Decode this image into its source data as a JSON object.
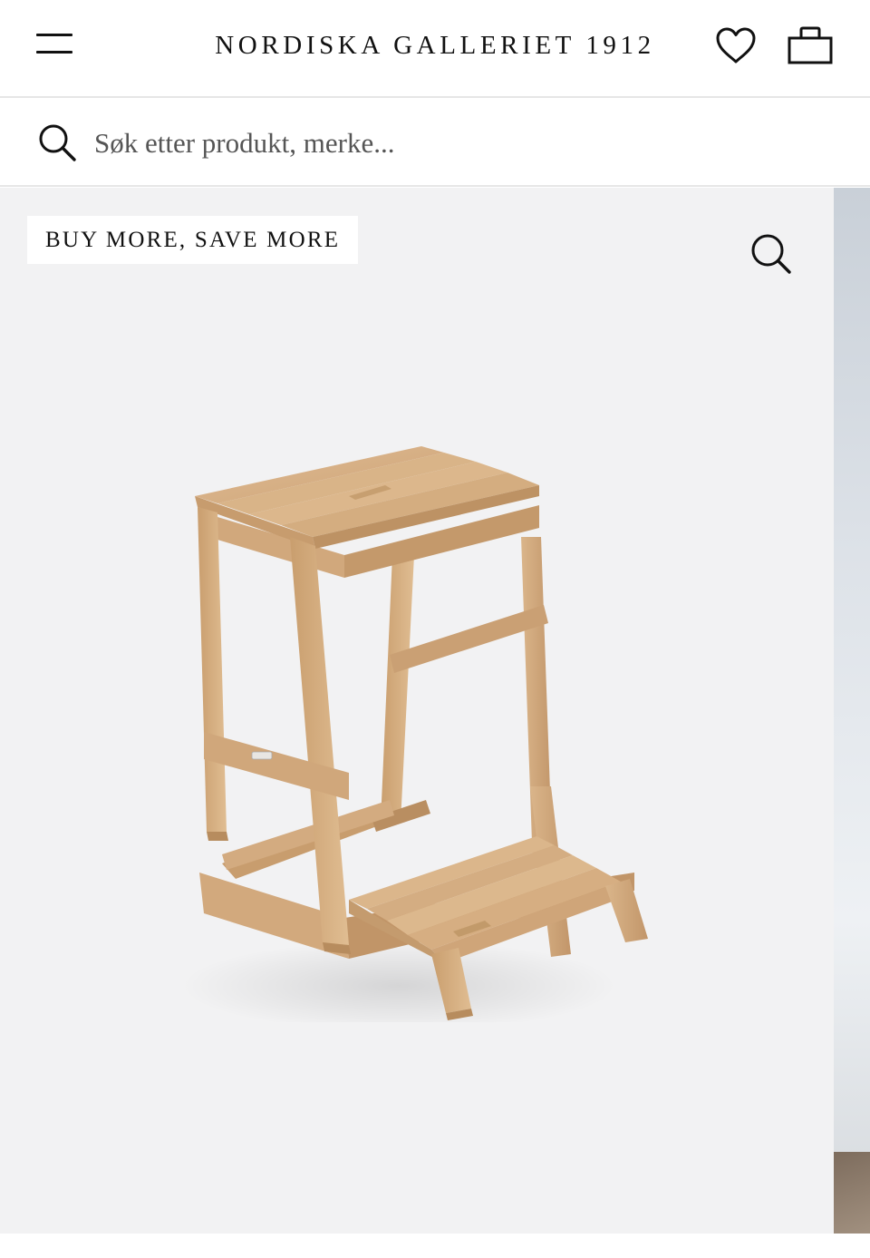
{
  "header": {
    "brand": "NORDISKA GALLERIET 1912",
    "menu_icon": "menu-icon",
    "wishlist_icon": "heart-icon",
    "cart_icon": "shopping-bag-icon"
  },
  "search": {
    "placeholder": "Søk etter produkt, merke...",
    "icon": "search-icon"
  },
  "product_gallery": {
    "badge": "BUY MORE, SAVE MORE",
    "zoom_icon": "zoom-icon",
    "image_subject": "oak-step-stool",
    "background_color": "#f2f2f3"
  },
  "colors": {
    "text": "#111111",
    "divider": "#e6e6e6",
    "wood_light": "#dcb68a",
    "wood_mid": "#c89e6d",
    "wood_dark": "#a97b4e"
  }
}
